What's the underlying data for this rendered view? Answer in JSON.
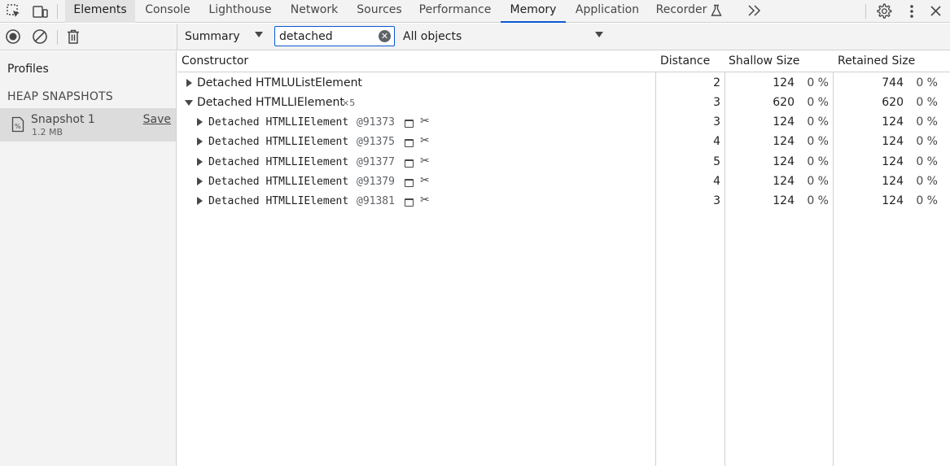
{
  "tabs": [
    {
      "label": "Elements"
    },
    {
      "label": "Console"
    },
    {
      "label": "Lighthouse"
    },
    {
      "label": "Network"
    },
    {
      "label": "Sources"
    },
    {
      "label": "Performance"
    },
    {
      "label": "Memory"
    },
    {
      "label": "Application"
    },
    {
      "label": "Recorder"
    }
  ],
  "toolbar": {
    "view_label": "Summary",
    "filter_value": "detached",
    "scope_label": "All objects"
  },
  "sidebar": {
    "title": "Profiles",
    "section": "HEAP SNAPSHOTS",
    "snapshot": {
      "title": "Snapshot 1",
      "size": "1.2 MB",
      "save_label": "Save"
    }
  },
  "table": {
    "headers": {
      "constructor": "Constructor",
      "distance": "Distance",
      "shallow": "Shallow Size",
      "retained": "Retained Size"
    },
    "rows": [
      {
        "name": "Detached HTMLUListElement",
        "count": "",
        "id": "",
        "distance": "2",
        "shallow": "124",
        "shallow_pct": "0 %",
        "retained": "744",
        "retained_pct": "0 %"
      },
      {
        "name": "Detached HTMLLIElement",
        "count": "×5",
        "id": "",
        "distance": "3",
        "shallow": "620",
        "shallow_pct": "0 %",
        "retained": "620",
        "retained_pct": "0 %"
      },
      {
        "name": "Detached HTMLLIElement",
        "count": "",
        "id": "@91373",
        "distance": "3",
        "shallow": "124",
        "shallow_pct": "0 %",
        "retained": "124",
        "retained_pct": "0 %"
      },
      {
        "name": "Detached HTMLLIElement",
        "count": "",
        "id": "@91375",
        "distance": "4",
        "shallow": "124",
        "shallow_pct": "0 %",
        "retained": "124",
        "retained_pct": "0 %"
      },
      {
        "name": "Detached HTMLLIElement",
        "count": "",
        "id": "@91377",
        "distance": "5",
        "shallow": "124",
        "shallow_pct": "0 %",
        "retained": "124",
        "retained_pct": "0 %"
      },
      {
        "name": "Detached HTMLLIElement",
        "count": "",
        "id": "@91379",
        "distance": "4",
        "shallow": "124",
        "shallow_pct": "0 %",
        "retained": "124",
        "retained_pct": "0 %"
      },
      {
        "name": "Detached HTMLLIElement",
        "count": "",
        "id": "@91381",
        "distance": "3",
        "shallow": "124",
        "shallow_pct": "0 %",
        "retained": "124",
        "retained_pct": "0 %"
      }
    ]
  }
}
